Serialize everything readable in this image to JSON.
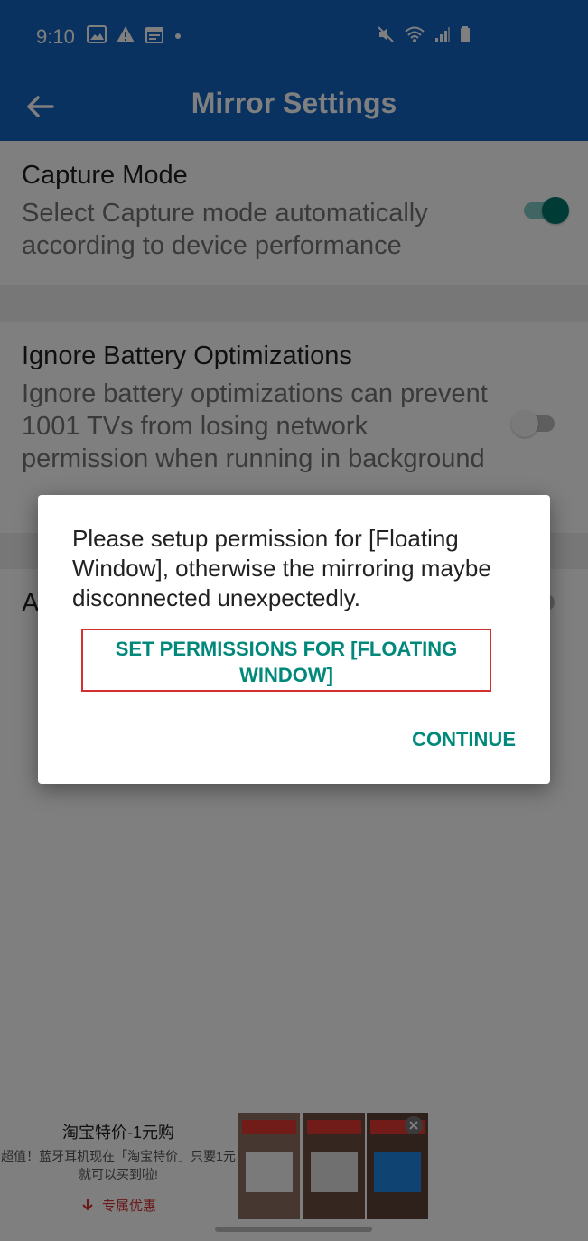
{
  "status_bar": {
    "time": "9:10",
    "left_icons": [
      "image-icon",
      "warning-icon",
      "calendar-icon",
      "dot-icon"
    ],
    "right_icons": [
      "mute-icon",
      "wifi-icon",
      "signal-icon",
      "battery-icon"
    ]
  },
  "app_bar": {
    "back_icon": "back-arrow-icon",
    "title": "Mirror Settings",
    "background_color": "#1565c0"
  },
  "settings": [
    {
      "title": "Capture Mode",
      "description": "Select Capture mode automatically according to device performance",
      "toggle_on": true
    },
    {
      "title": "Ignore Battery Optimizations",
      "description": "Ignore battery optimizations can prevent 1001 TVs from losing network permission when running in background",
      "toggle_on": false
    },
    {
      "title": "A",
      "toggle_on": false
    }
  ],
  "dialog": {
    "message": "Please setup permission for [Floating Window], otherwise the mirroring maybe disconnected unexpectedly.",
    "permission_button_label": "SET PERMISSIONS FOR [FLOATING WINDOW]",
    "continue_label": "CONTINUE",
    "accent_color": "#00897b"
  },
  "ad": {
    "title": "淘宝特价-1元购",
    "description": "超值！蓝牙耳机现在「淘宝特价」只要1元就可以买到啦!",
    "cta_label": "专属优惠",
    "cta_icon": "download-arrow-icon",
    "close_icon": "close-icon"
  },
  "colors": {
    "toggle_on": "#00796b",
    "highlight_border": "#d32f2f"
  }
}
